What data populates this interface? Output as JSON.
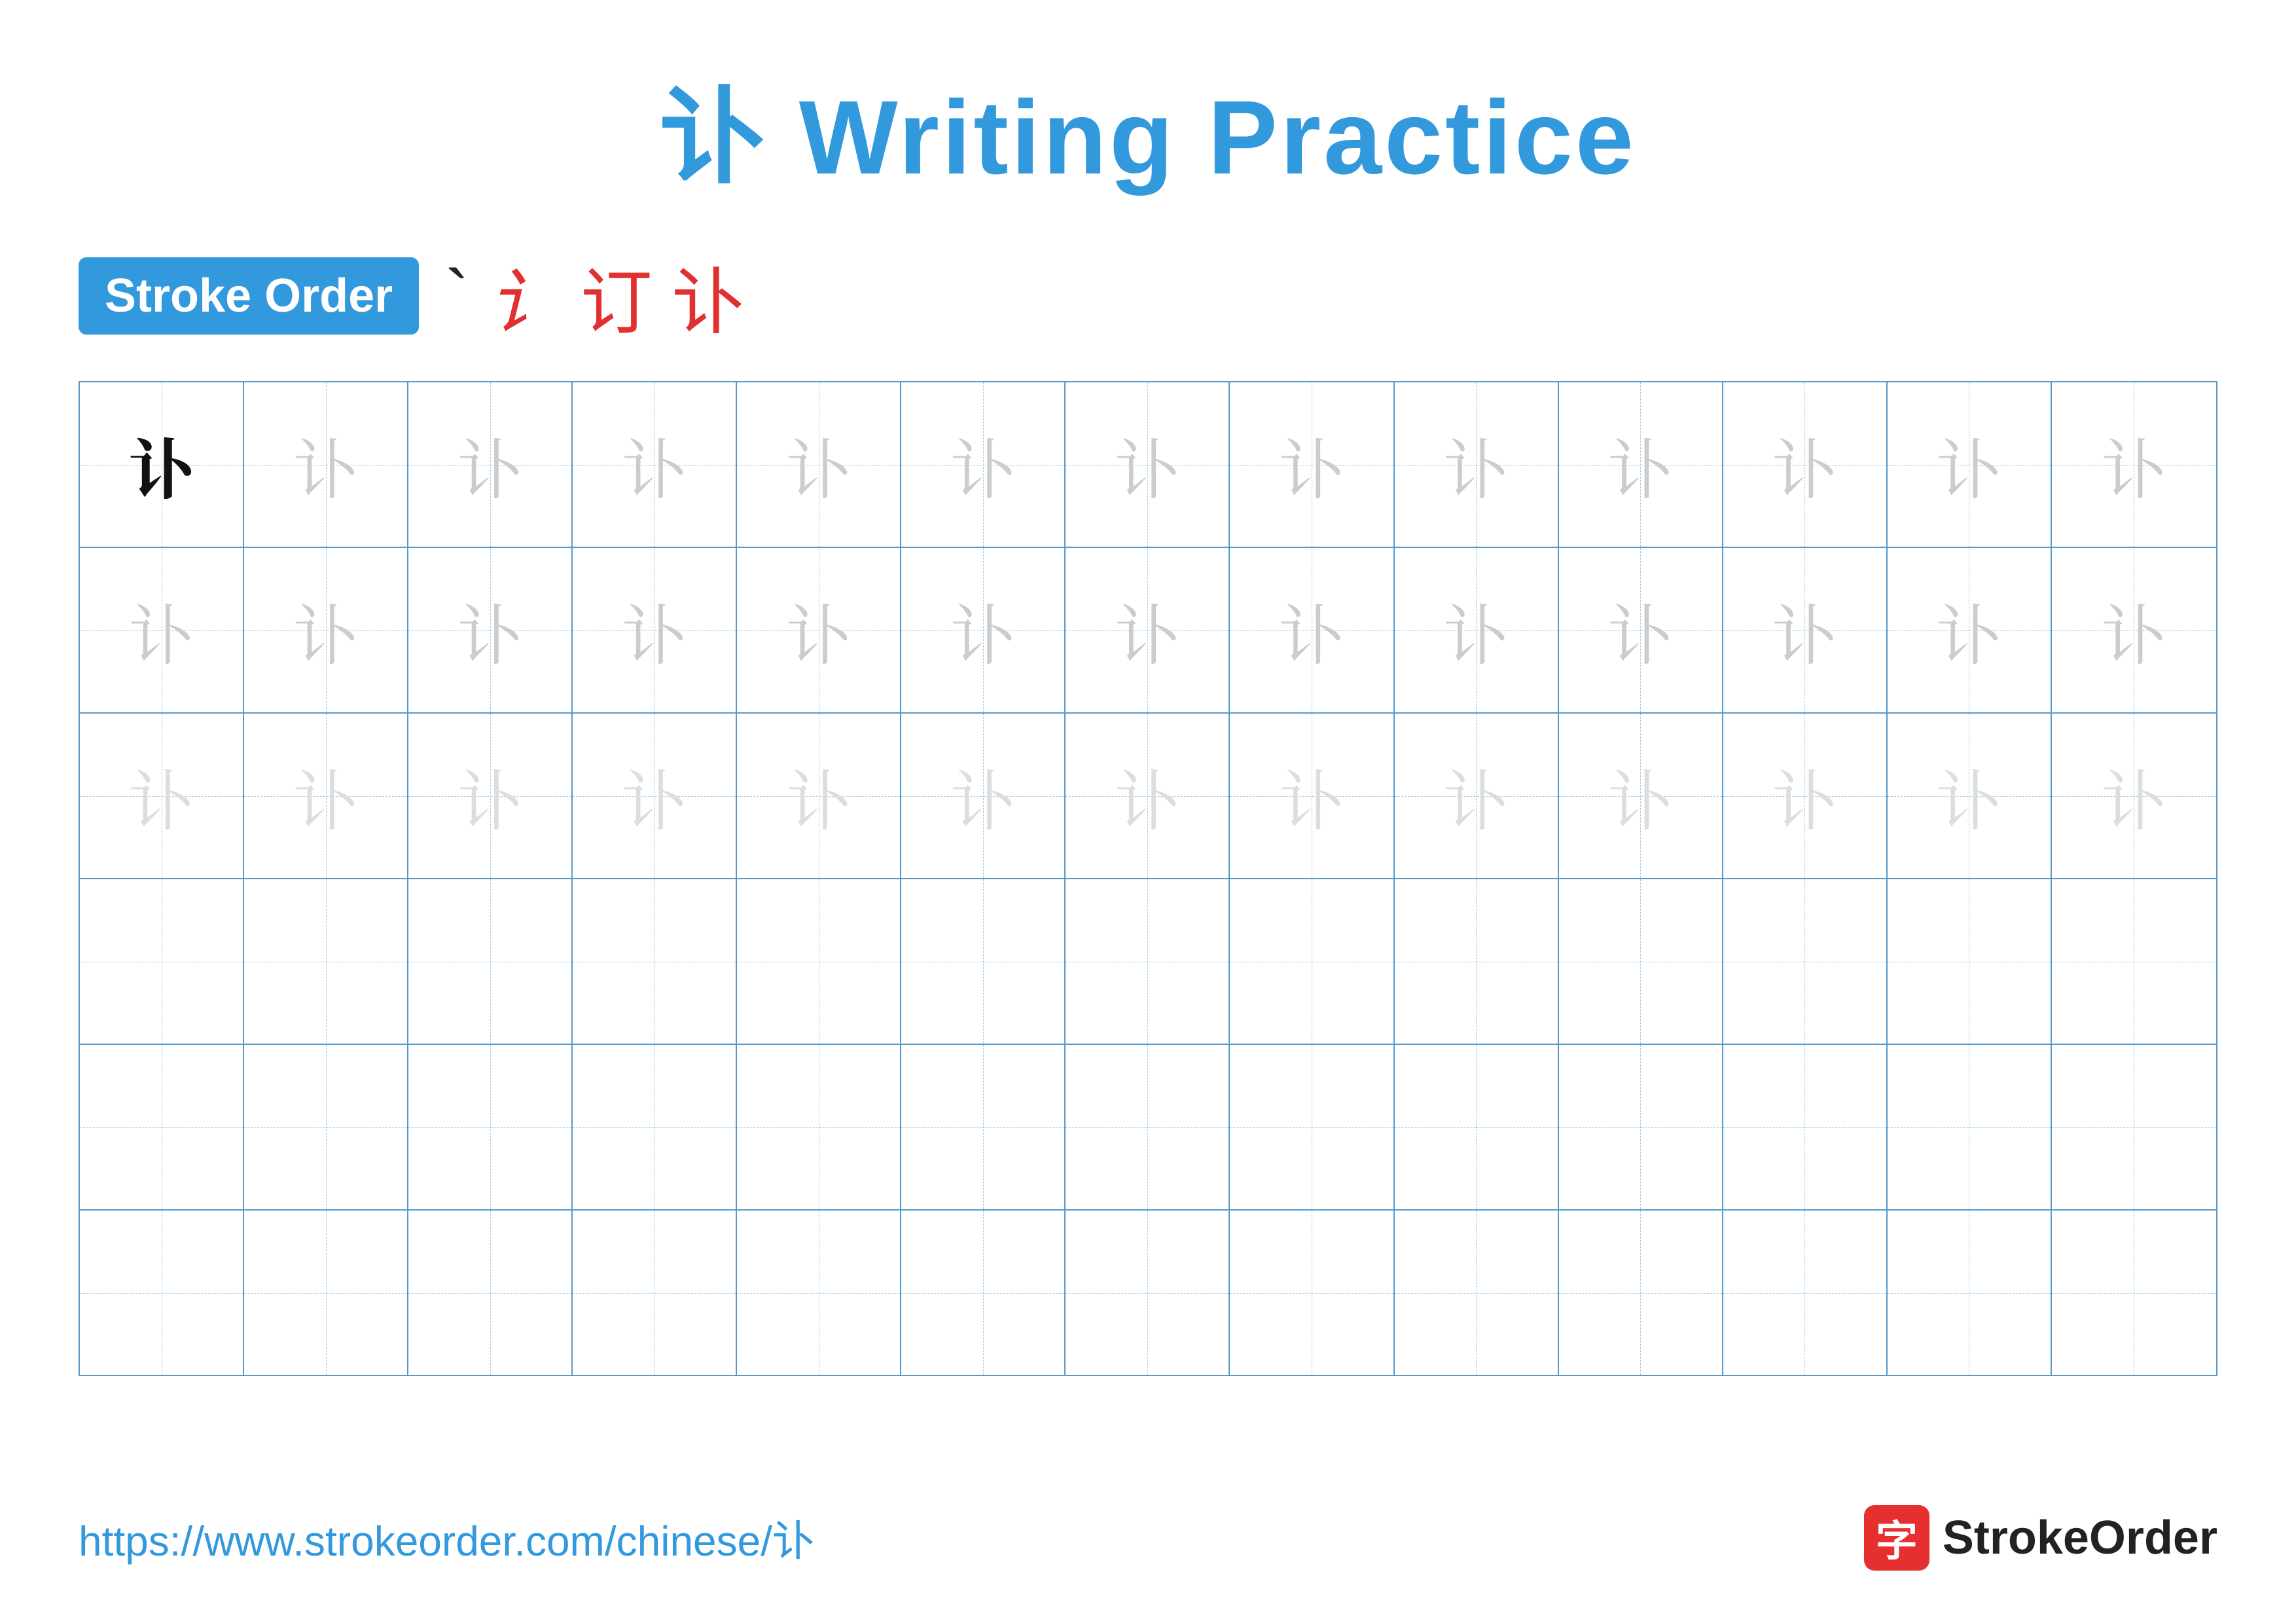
{
  "title": {
    "char": "讣",
    "label": "Writing Practice",
    "full": "讣 Writing Practice"
  },
  "stroke_order": {
    "badge_label": "Stroke Order",
    "strokes": [
      {
        "char": "`",
        "color": "dark"
      },
      {
        "char": "讠",
        "color": "red"
      },
      {
        "char": "订",
        "color": "red"
      },
      {
        "char": "讣",
        "color": "red"
      }
    ]
  },
  "grid": {
    "cols": 13,
    "rows": [
      {
        "type": "practice",
        "cells": [
          {
            "char": "讣",
            "style": "dark"
          },
          {
            "char": "讣",
            "style": "light"
          },
          {
            "char": "讣",
            "style": "light"
          },
          {
            "char": "讣",
            "style": "light"
          },
          {
            "char": "讣",
            "style": "light"
          },
          {
            "char": "讣",
            "style": "light"
          },
          {
            "char": "讣",
            "style": "light"
          },
          {
            "char": "讣",
            "style": "light"
          },
          {
            "char": "讣",
            "style": "light"
          },
          {
            "char": "讣",
            "style": "light"
          },
          {
            "char": "讣",
            "style": "light"
          },
          {
            "char": "讣",
            "style": "light"
          },
          {
            "char": "讣",
            "style": "light"
          }
        ]
      },
      {
        "type": "practice",
        "cells": [
          {
            "char": "讣",
            "style": "light"
          },
          {
            "char": "讣",
            "style": "light"
          },
          {
            "char": "讣",
            "style": "light"
          },
          {
            "char": "讣",
            "style": "light"
          },
          {
            "char": "讣",
            "style": "light"
          },
          {
            "char": "讣",
            "style": "light"
          },
          {
            "char": "讣",
            "style": "light"
          },
          {
            "char": "讣",
            "style": "light"
          },
          {
            "char": "讣",
            "style": "light"
          },
          {
            "char": "讣",
            "style": "light"
          },
          {
            "char": "讣",
            "style": "light"
          },
          {
            "char": "讣",
            "style": "light"
          },
          {
            "char": "讣",
            "style": "light"
          }
        ]
      },
      {
        "type": "practice",
        "cells": [
          {
            "char": "讣",
            "style": "lighter"
          },
          {
            "char": "讣",
            "style": "lighter"
          },
          {
            "char": "讣",
            "style": "lighter"
          },
          {
            "char": "讣",
            "style": "lighter"
          },
          {
            "char": "讣",
            "style": "lighter"
          },
          {
            "char": "讣",
            "style": "lighter"
          },
          {
            "char": "讣",
            "style": "lighter"
          },
          {
            "char": "讣",
            "style": "lighter"
          },
          {
            "char": "讣",
            "style": "lighter"
          },
          {
            "char": "讣",
            "style": "lighter"
          },
          {
            "char": "讣",
            "style": "lighter"
          },
          {
            "char": "讣",
            "style": "lighter"
          },
          {
            "char": "讣",
            "style": "lighter"
          }
        ]
      },
      {
        "type": "empty"
      },
      {
        "type": "empty"
      },
      {
        "type": "empty"
      }
    ]
  },
  "footer": {
    "url": "https://www.strokeorder.com/chinese/讣",
    "brand_icon_char": "字",
    "brand_name": "StrokeOrder"
  }
}
